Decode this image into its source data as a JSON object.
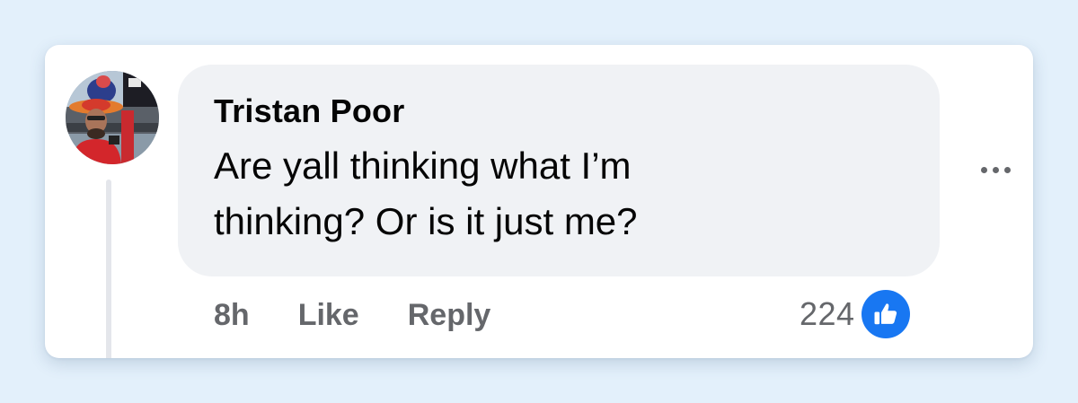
{
  "comment": {
    "author": "Tristan Poor",
    "text": "Are yall thinking what I’m thinking? Or is it just me?",
    "timestamp": "8h",
    "like_label": "Like",
    "reply_label": "Reply",
    "reaction_count": "224",
    "reaction_icon": "thumbs-up-icon",
    "more_icon": "more-options-icon"
  },
  "colors": {
    "page_background": "#e3f0fb",
    "bubble_background": "#f0f2f5",
    "muted_text": "#65676b",
    "like_blue": "#1877f2"
  }
}
